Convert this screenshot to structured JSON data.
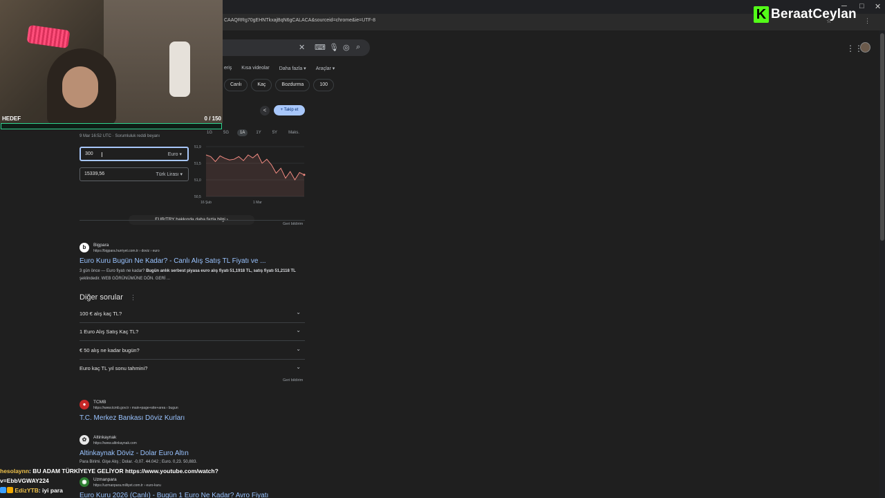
{
  "browser": {
    "url_tail": "CAAQRRg70gEHNTkxajBqN6gCALACA&sourceid=chrome&ie=UTF-8",
    "window_controls": [
      "─",
      "□",
      "✕"
    ]
  },
  "brand": {
    "logo_letter": "K",
    "name": "BeraatCeylan",
    "accent": "#53fc18"
  },
  "webcam": {
    "goal_label": "HEDEF",
    "goal_count": "0  / 150",
    "goal_progress": 0
  },
  "search": {
    "tabs": [
      "eriş",
      "Kısa videolar",
      "Daha fazla ▾",
      "Araçlar ▾"
    ],
    "chips": [
      "Canlı",
      "Kaç",
      "Bozdurma",
      "100"
    ]
  },
  "finance": {
    "follow_label": "+ Takip et",
    "timestamp": "9 Mar 16:52 UTC · Sorumluluk reddi beyanı",
    "range_tabs": [
      "1G",
      "5G",
      "1A",
      "1Y",
      "5Y",
      "Maks."
    ],
    "active_range": "1A",
    "from_value": "300",
    "from_currency": "Euro",
    "to_value": "15339,56",
    "to_currency": "Türk Lirası",
    "more_info": "EUR/TRY hakkında daha fazla bilgi  ›",
    "feedback": "Geri bildirim"
  },
  "chart_data": {
    "type": "line",
    "title": "",
    "xlabel": "",
    "ylabel": "",
    "x": [
      "16 Şub",
      "",
      "",
      "",
      "",
      "",
      "",
      "",
      "",
      "",
      "",
      "1 Mar",
      "",
      "",
      "",
      "",
      "",
      "",
      "",
      "",
      "",
      ""
    ],
    "y_ticks": [
      52,
      51.5,
      51,
      50.5
    ],
    "y_tick_labels": [
      "51,9",
      "51,5",
      "51,0",
      "50,5"
    ],
    "x_tick_labels": [
      "16 Şub",
      "1 Mar"
    ],
    "series": [
      {
        "values": [
          51.75,
          51.7,
          51.55,
          51.72,
          51.65,
          51.6,
          51.62,
          51.7,
          51.58,
          51.75,
          51.66,
          51.78,
          51.5,
          51.62,
          51.45,
          51.2,
          51.35,
          51.05,
          51.25,
          51.0,
          51.22,
          51.15
        ]
      }
    ],
    "ylim": [
      50.5,
      52
    ],
    "color": "#f28b82"
  },
  "results": [
    {
      "site": "Bigpara",
      "url": "https://bigpara.hurriyet.com.tr › doviz › euro",
      "title": "Euro Kuru Bugün Ne Kadar? - Canlı Alış Satış TL Fiyatı ve ...",
      "snippet_plain_1": "3 gün önce — Euro fiyatı ne kadar? ",
      "snippet_bold_1": "Bugün anlık serbest piyasa euro alış fiyatı 51,1918 TL, satış fiyatı 51,2118 TL",
      "snippet_plain_2": " şeklindedir. WEB GÖRÜNÜMÜNE DÖN. GERİ ..."
    },
    {
      "site": "TCMB",
      "url": "https://www.tcmb.gov.tr › main+page+site+area › bugun",
      "title": "T.C. Merkez Bankası Döviz Kurları"
    },
    {
      "site": "Altinkaynak",
      "url": "https://www.altinkaynak.com",
      "title": "Altinkaynak Döviz - Dolar Euro Altın",
      "snippet": "Para Birimi. Gişe Alış ; Dolar. -0,07. 44.042 ; Euro. 0,23. 50,883."
    },
    {
      "site": "Uzmanpara",
      "url": "https://uzmanpara.milliyet.com.tr › euro-kuru",
      "title": "Euro Kuru 2026 (Canlı) - Bugün 1 Euro Ne Kadar? Avro Fiyatı"
    }
  ],
  "paa": {
    "title": "Diğer sorular",
    "questions": [
      "100 € alış kaç TL?",
      "1 Euro Alış Satış Kaç TL?",
      "€ 50 alış ne kadar bugün?",
      "Euro kaç TL yıl sonu tahmini?"
    ],
    "feedback": "Geri bildirim"
  },
  "chat": [
    {
      "user": "hesolaynn",
      "text": ": BU ADAM TÜRKİYEYE GELİYOR https://www.youtube.com/watch?v=EbbVGWAY224"
    },
    {
      "user": "EdizYTB",
      "text": ": iyi para"
    }
  ]
}
